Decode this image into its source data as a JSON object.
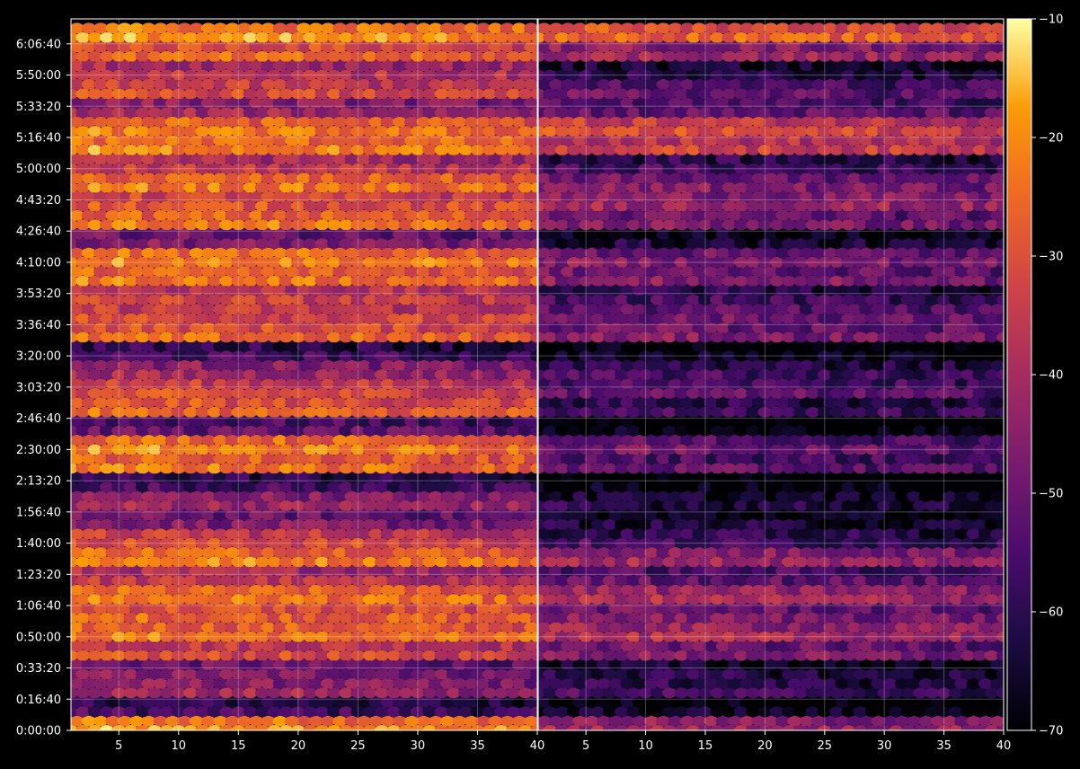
{
  "chart_data": {
    "type": "heatmap",
    "title": "",
    "xlabel": "",
    "ylabel": "",
    "grid": true,
    "colormap": "inferno",
    "background": "#000000",
    "foreground": "#ffffff",
    "panels": [
      {
        "name": "",
        "xlim": [
          1,
          40
        ],
        "xticks": [
          5,
          10,
          15,
          20,
          25,
          30,
          35,
          40
        ],
        "summary": "high-level heatmap cells (mostly -35 to -20 dB)"
      },
      {
        "name": "",
        "xlim": [
          1,
          40
        ],
        "xticks": [
          5,
          10,
          15,
          20,
          25,
          30,
          35,
          40
        ],
        "summary": "lower-level heatmap cells (mostly -70 to -35 dB)"
      }
    ],
    "y_axis": {
      "range_seconds": [
        0,
        22800
      ],
      "tick_labels": [
        "0:00:00",
        "0:16:40",
        "0:33:20",
        "0:50:00",
        "1:06:40",
        "1:23:20",
        "1:40:00",
        "1:56:40",
        "2:13:20",
        "2:30:00",
        "2:46:40",
        "3:03:20",
        "3:20:00",
        "3:36:40",
        "3:53:20",
        "4:10:00",
        "4:26:40",
        "4:43:20",
        "5:00:00",
        "5:16:40",
        "5:33:20",
        "5:50:00",
        "6:06:40"
      ]
    },
    "colorbar": {
      "range": [
        -70,
        -10
      ],
      "tick_labels": [
        "−10",
        "−20",
        "−30",
        "−40",
        "−50",
        "−60",
        "−70"
      ],
      "tick_values": [
        -10,
        -20,
        -30,
        -40,
        -50,
        -60,
        -70
      ]
    },
    "row_profile": [
      {
        "t_seconds": 0,
        "left": -18,
        "right": -40
      },
      {
        "t_seconds": 600,
        "left": -55,
        "right": -65
      },
      {
        "t_seconds": 1200,
        "left": -40,
        "right": -55
      },
      {
        "t_seconds": 1800,
        "left": -45,
        "right": -60
      },
      {
        "t_seconds": 2400,
        "left": -30,
        "right": -45
      },
      {
        "t_seconds": 3000,
        "left": -22,
        "right": -38
      },
      {
        "t_seconds": 3600,
        "left": -25,
        "right": -45
      },
      {
        "t_seconds": 4200,
        "left": -22,
        "right": -38
      },
      {
        "t_seconds": 4800,
        "left": -35,
        "right": -50
      },
      {
        "t_seconds": 5400,
        "left": -20,
        "right": -40
      },
      {
        "t_seconds": 6000,
        "left": -30,
        "right": -55
      },
      {
        "t_seconds": 6600,
        "left": -45,
        "right": -62
      },
      {
        "t_seconds": 7200,
        "left": -40,
        "right": -60
      },
      {
        "t_seconds": 7800,
        "left": -55,
        "right": -68
      },
      {
        "t_seconds": 8400,
        "left": -22,
        "right": -50
      },
      {
        "t_seconds": 9000,
        "left": -20,
        "right": -48
      },
      {
        "t_seconds": 9600,
        "left": -50,
        "right": -68
      },
      {
        "t_seconds": 10200,
        "left": -25,
        "right": -55
      },
      {
        "t_seconds": 10800,
        "left": -30,
        "right": -50
      },
      {
        "t_seconds": 11400,
        "left": -40,
        "right": -55
      },
      {
        "t_seconds": 12000,
        "left": -55,
        "right": -66
      },
      {
        "t_seconds": 12600,
        "left": -25,
        "right": -45
      },
      {
        "t_seconds": 13200,
        "left": -30,
        "right": -48
      },
      {
        "t_seconds": 13800,
        "left": -32,
        "right": -55
      },
      {
        "t_seconds": 14400,
        "left": -22,
        "right": -45
      },
      {
        "t_seconds": 15000,
        "left": -20,
        "right": -45
      },
      {
        "t_seconds": 15600,
        "left": -45,
        "right": -62
      },
      {
        "t_seconds": 16200,
        "left": -22,
        "right": -45
      },
      {
        "t_seconds": 16800,
        "left": -28,
        "right": -40
      },
      {
        "t_seconds": 17400,
        "left": -22,
        "right": -45
      },
      {
        "t_seconds": 18000,
        "left": -35,
        "right": -55
      },
      {
        "t_seconds": 18600,
        "left": -20,
        "right": -32
      },
      {
        "t_seconds": 19200,
        "left": -22,
        "right": -30
      },
      {
        "t_seconds": 19800,
        "left": -40,
        "right": -50
      },
      {
        "t_seconds": 20400,
        "left": -30,
        "right": -50
      },
      {
        "t_seconds": 21000,
        "left": -35,
        "right": -60
      },
      {
        "t_seconds": 21600,
        "left": -25,
        "right": -40
      },
      {
        "t_seconds": 22200,
        "left": -18,
        "right": -25
      }
    ]
  }
}
